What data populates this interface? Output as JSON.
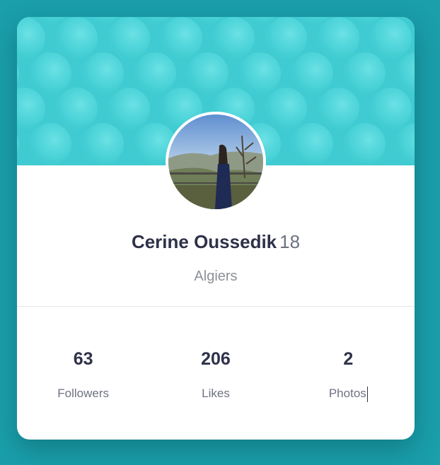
{
  "profile": {
    "name": "Cerine Oussedik",
    "age": "18",
    "location": "Algiers"
  },
  "stats": [
    {
      "value": "63",
      "label": "Followers"
    },
    {
      "value": "206",
      "label": "Likes"
    },
    {
      "value": "2",
      "label": "Photos"
    }
  ],
  "colors": {
    "page_background": "#1a9fab",
    "banner": "#3fcbd1",
    "text_dark": "#2e3148",
    "text_muted": "#8c9098"
  }
}
